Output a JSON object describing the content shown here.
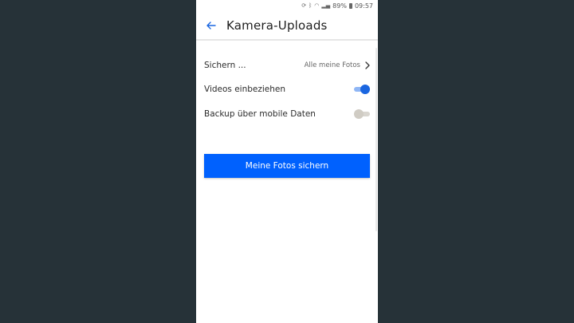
{
  "statusbar": {
    "battery": "89%",
    "time": "09:57",
    "icons": [
      "sync-icon",
      "bluetooth-icon",
      "wifi-icon",
      "signal-icon",
      "battery-icon"
    ]
  },
  "appbar": {
    "title": "Kamera-Uploads",
    "back_icon": "arrow-left-icon"
  },
  "settings": {
    "backup": {
      "label": "Sichern ...",
      "value": "Alle meine Fotos"
    },
    "videos": {
      "label": "Videos einbeziehen",
      "enabled": true
    },
    "mobile_data": {
      "label": "Backup über mobile Daten",
      "enabled": false
    }
  },
  "action": {
    "label": "Meine Fotos sichern"
  },
  "colors": {
    "accent": "#0061fe",
    "toggle_on": "#1a66e0",
    "background_outer": "#263238"
  }
}
